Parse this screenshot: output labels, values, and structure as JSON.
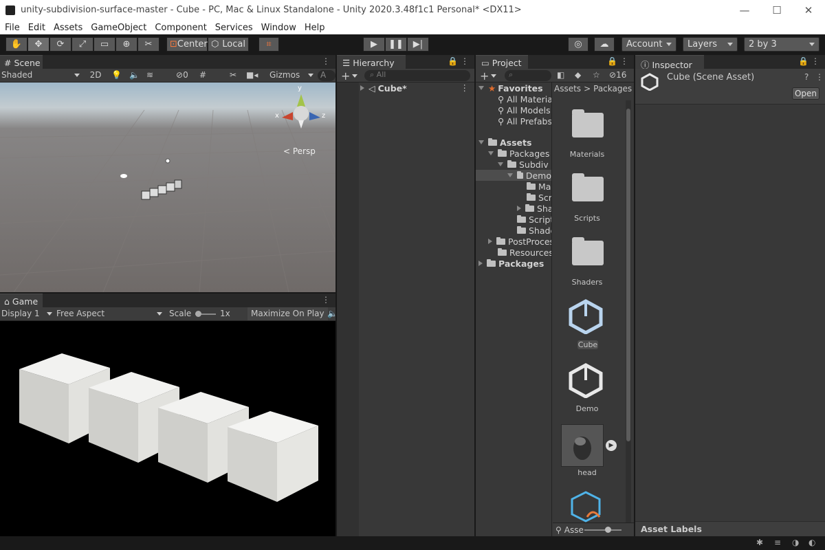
{
  "window": {
    "title": "unity-subdivision-surface-master - Cube - PC, Mac & Linux Standalone - Unity 2020.3.48f1c1 Personal* <DX11>",
    "minimize": "—",
    "maximize": "☐",
    "close": "✕"
  },
  "menu": [
    "File",
    "Edit",
    "Assets",
    "GameObject",
    "Component",
    "Services",
    "Window",
    "Help"
  ],
  "toolbar": {
    "pivot_label": "Center",
    "space_label": "Local",
    "account_label": "Account",
    "layers_label": "Layers",
    "layout_label": "2 by 3"
  },
  "scene": {
    "tab_label": "Scene",
    "shading_mode": "Shaded",
    "mode_2d": "2D",
    "hidden_count": "0",
    "gizmos_label": "Gizmos",
    "search_glyph": "A",
    "persp_label": "< Persp",
    "axis_x": "x",
    "axis_y": "y",
    "axis_z": "z"
  },
  "game": {
    "tab_label": "Game",
    "display": "Display 1",
    "aspect": "Free Aspect",
    "scale_label": "Scale",
    "scale_value": "1x",
    "maximize_label": "Maximize On Play"
  },
  "hierarchy": {
    "tab_label": "Hierarchy",
    "add_label": "+",
    "search_placeholder": "All",
    "scene_item": "Cube*"
  },
  "project": {
    "tab_label": "Project",
    "add_label": "+",
    "hidden_count": "16",
    "breadcrumb_root": "Assets",
    "breadcrumb_sep": ">",
    "breadcrumb_current": "Packages",
    "tree": {
      "favorites": "Favorites",
      "fav_items": [
        "All Materia",
        "All Models",
        "All Prefabs"
      ],
      "assets": "Assets",
      "packages": "Packages",
      "subdiv": "Subdiv",
      "demo": "Demo",
      "ma": "Ma",
      "scr": "Scr",
      "sha": "Sha",
      "scripts": "Script",
      "shaders": "Shade",
      "postproc": "PostProces",
      "resources": "Resources",
      "root_packages": "Packages"
    },
    "grid": [
      "Materials",
      "Scripts",
      "Shaders",
      "Cube",
      "Demo",
      "head"
    ],
    "zoom_label": "Asse"
  },
  "inspector": {
    "tab_label": "Inspector",
    "asset_title": "Cube (Scene Asset)",
    "open_label": "Open",
    "footer": "Asset Labels"
  },
  "colors": {
    "accent_blue": "#2c5d87",
    "panel_bg": "#383838",
    "favorites_star": "#e06c2c"
  }
}
